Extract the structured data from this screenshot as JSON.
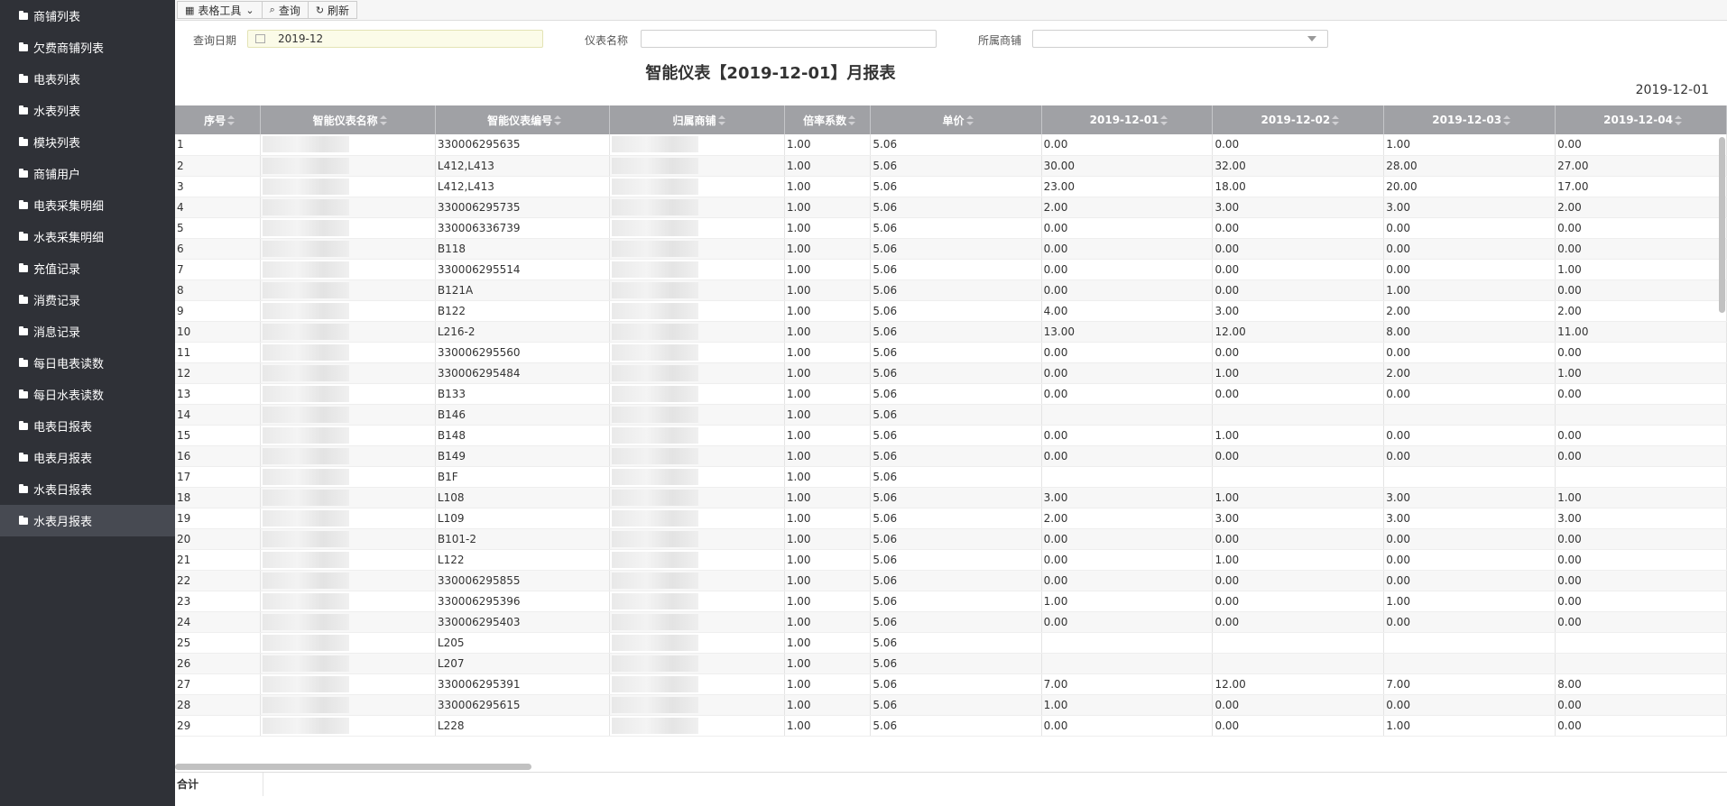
{
  "sidebar": {
    "items": [
      {
        "label": "商铺列表"
      },
      {
        "label": "欠费商铺列表"
      },
      {
        "label": "电表列表"
      },
      {
        "label": "水表列表"
      },
      {
        "label": "模块列表"
      },
      {
        "label": "商铺用户"
      },
      {
        "label": "电表采集明细"
      },
      {
        "label": "水表采集明细"
      },
      {
        "label": "充值记录"
      },
      {
        "label": "消费记录"
      },
      {
        "label": "消息记录"
      },
      {
        "label": "每日电表读数"
      },
      {
        "label": "每日水表读数"
      },
      {
        "label": "电表日报表"
      },
      {
        "label": "电表月报表"
      },
      {
        "label": "水表日报表"
      },
      {
        "label": "水表月报表",
        "active": true
      }
    ]
  },
  "toolbar": {
    "table_tools": "表格工具",
    "query": "查询",
    "refresh": "刷新"
  },
  "filters": {
    "date_label": "查询日期",
    "date_value": "2019-12",
    "meter_name_label": "仪表名称",
    "meter_name_value": "",
    "shop_label": "所属商铺",
    "shop_value": ""
  },
  "report": {
    "title": "智能仪表【2019-12-01】月报表",
    "date": "2019-12-01"
  },
  "table": {
    "columns": [
      "序号",
      "智能仪表名称",
      "智能仪表编号",
      "归属商铺",
      "倍率系数",
      "单价",
      "2019-12-01",
      "2019-12-02",
      "2019-12-03",
      "2019-12-04"
    ],
    "rows": [
      [
        "1",
        "",
        "330006295635",
        "",
        "1.00",
        "5.06",
        "0.00",
        "0.00",
        "1.00",
        "0.00"
      ],
      [
        "2",
        "",
        "L412,L413",
        "",
        "1.00",
        "5.06",
        "30.00",
        "32.00",
        "28.00",
        "27.00"
      ],
      [
        "3",
        "",
        "L412,L413",
        "",
        "1.00",
        "5.06",
        "23.00",
        "18.00",
        "20.00",
        "17.00"
      ],
      [
        "4",
        "",
        "330006295735",
        "",
        "1.00",
        "5.06",
        "2.00",
        "3.00",
        "3.00",
        "2.00"
      ],
      [
        "5",
        "",
        "330006336739",
        "",
        "1.00",
        "5.06",
        "0.00",
        "0.00",
        "0.00",
        "0.00"
      ],
      [
        "6",
        "",
        "B118",
        "",
        "1.00",
        "5.06",
        "0.00",
        "0.00",
        "0.00",
        "0.00"
      ],
      [
        "7",
        "",
        "330006295514",
        "",
        "1.00",
        "5.06",
        "0.00",
        "0.00",
        "0.00",
        "1.00"
      ],
      [
        "8",
        "",
        "B121A",
        "",
        "1.00",
        "5.06",
        "0.00",
        "0.00",
        "1.00",
        "0.00"
      ],
      [
        "9",
        "",
        "B122",
        "",
        "1.00",
        "5.06",
        "4.00",
        "3.00",
        "2.00",
        "2.00"
      ],
      [
        "10",
        "",
        "L216-2",
        "",
        "1.00",
        "5.06",
        "13.00",
        "12.00",
        "8.00",
        "11.00"
      ],
      [
        "11",
        "",
        "330006295560",
        "",
        "1.00",
        "5.06",
        "0.00",
        "0.00",
        "0.00",
        "0.00"
      ],
      [
        "12",
        "",
        "330006295484",
        "",
        "1.00",
        "5.06",
        "0.00",
        "1.00",
        "2.00",
        "1.00"
      ],
      [
        "13",
        "",
        "B133",
        "",
        "1.00",
        "5.06",
        "0.00",
        "0.00",
        "0.00",
        "0.00"
      ],
      [
        "14",
        "",
        "B146",
        "",
        "1.00",
        "5.06",
        "",
        "",
        "",
        ""
      ],
      [
        "15",
        "",
        "B148",
        "",
        "1.00",
        "5.06",
        "0.00",
        "1.00",
        "0.00",
        "0.00"
      ],
      [
        "16",
        "",
        "B149",
        "",
        "1.00",
        "5.06",
        "0.00",
        "0.00",
        "0.00",
        "0.00"
      ],
      [
        "17",
        "",
        "B1F",
        "",
        "1.00",
        "5.06",
        "",
        "",
        "",
        ""
      ],
      [
        "18",
        "",
        "L108",
        "",
        "1.00",
        "5.06",
        "3.00",
        "1.00",
        "3.00",
        "1.00"
      ],
      [
        "19",
        "",
        "L109",
        "",
        "1.00",
        "5.06",
        "2.00",
        "3.00",
        "3.00",
        "3.00"
      ],
      [
        "20",
        "",
        "B101-2",
        "",
        "1.00",
        "5.06",
        "0.00",
        "0.00",
        "0.00",
        "0.00"
      ],
      [
        "21",
        "",
        "L122",
        "",
        "1.00",
        "5.06",
        "0.00",
        "1.00",
        "0.00",
        "0.00"
      ],
      [
        "22",
        "",
        "330006295855",
        "",
        "1.00",
        "5.06",
        "0.00",
        "0.00",
        "0.00",
        "0.00"
      ],
      [
        "23",
        "",
        "330006295396",
        "",
        "1.00",
        "5.06",
        "1.00",
        "0.00",
        "1.00",
        "0.00"
      ],
      [
        "24",
        "",
        "330006295403",
        "",
        "1.00",
        "5.06",
        "0.00",
        "0.00",
        "0.00",
        "0.00"
      ],
      [
        "25",
        "",
        "L205",
        "",
        "1.00",
        "5.06",
        "",
        "",
        "",
        ""
      ],
      [
        "26",
        "",
        "L207",
        "",
        "1.00",
        "5.06",
        "",
        "",
        "",
        ""
      ],
      [
        "27",
        "",
        "330006295391",
        "",
        "1.00",
        "5.06",
        "7.00",
        "12.00",
        "7.00",
        "8.00"
      ],
      [
        "28",
        "",
        "330006295615",
        "",
        "1.00",
        "5.06",
        "1.00",
        "0.00",
        "0.00",
        "0.00"
      ],
      [
        "29",
        "",
        "L228",
        "",
        "1.00",
        "5.06",
        "0.00",
        "0.00",
        "1.00",
        "0.00"
      ]
    ],
    "footer_label": "合计"
  }
}
